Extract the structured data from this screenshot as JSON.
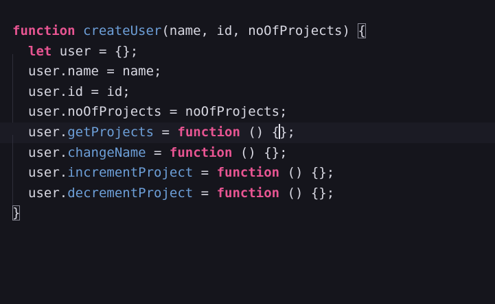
{
  "code": {
    "lines": [
      {
        "tokens": [
          {
            "text": "function",
            "kind": "kw"
          },
          {
            "text": " ",
            "kind": "plain"
          },
          {
            "text": "createUser",
            "kind": "fn"
          },
          {
            "text": "(name, id, noOfProjects) ",
            "kind": "plain"
          },
          {
            "text": "{",
            "kind": "plain",
            "match": true
          }
        ]
      },
      {
        "indent": true,
        "tokens": [
          {
            "text": "let",
            "kind": "kw"
          },
          {
            "text": " user = {};",
            "kind": "plain"
          }
        ]
      },
      {
        "indent": true,
        "tokens": [
          {
            "text": "user.name = name;",
            "kind": "plain"
          }
        ]
      },
      {
        "indent": true,
        "tokens": [
          {
            "text": "user.id = id;",
            "kind": "plain"
          }
        ]
      },
      {
        "indent": true,
        "tokens": [
          {
            "text": "user.noOfProjects = noOfProjects;",
            "kind": "plain"
          }
        ]
      },
      {
        "indent": true,
        "current": true,
        "tokens": [
          {
            "text": "user.",
            "kind": "plain"
          },
          {
            "text": "getProjects",
            "kind": "prop"
          },
          {
            "text": " = ",
            "kind": "plain"
          },
          {
            "text": "function",
            "kind": "kw"
          },
          {
            "text": " () {",
            "kind": "plain"
          },
          {
            "text": "",
            "kind": "cursor"
          },
          {
            "text": "};",
            "kind": "plain"
          }
        ]
      },
      {
        "indent": true,
        "tokens": [
          {
            "text": "user.",
            "kind": "plain"
          },
          {
            "text": "changeName",
            "kind": "prop"
          },
          {
            "text": " = ",
            "kind": "plain"
          },
          {
            "text": "function",
            "kind": "kw"
          },
          {
            "text": " () {};",
            "kind": "plain"
          }
        ]
      },
      {
        "indent": true,
        "tokens": [
          {
            "text": "user.",
            "kind": "plain"
          },
          {
            "text": "incrementProject",
            "kind": "prop"
          },
          {
            "text": " = ",
            "kind": "plain"
          },
          {
            "text": "function",
            "kind": "kw"
          },
          {
            "text": " () {};",
            "kind": "plain"
          }
        ]
      },
      {
        "indent": true,
        "tokens": [
          {
            "text": "user.",
            "kind": "plain"
          },
          {
            "text": "decrementProject",
            "kind": "prop"
          },
          {
            "text": " = ",
            "kind": "plain"
          },
          {
            "text": "function",
            "kind": "kw"
          },
          {
            "text": " () {};",
            "kind": "plain"
          }
        ]
      },
      {
        "tokens": [
          {
            "text": "}",
            "kind": "plain",
            "match": true
          }
        ]
      }
    ]
  },
  "colors": {
    "background": "#15151c",
    "keyword": "#e85592",
    "identifier": "#6d9fd8",
    "text": "#d8d8e2"
  }
}
